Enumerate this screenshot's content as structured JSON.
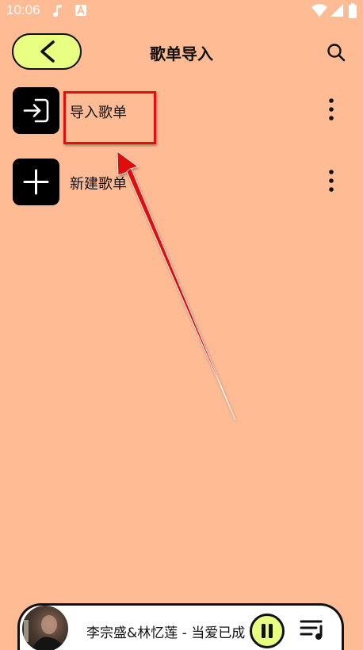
{
  "status_bar": {
    "time": "10:06",
    "icons": [
      "music-note-icon",
      "font-a-icon",
      "wifi-icon",
      "signal-icon",
      "battery-icon"
    ]
  },
  "header": {
    "title": "歌单导入",
    "back_icon": "chevron-left-icon",
    "search_icon": "search-icon"
  },
  "list": [
    {
      "label": "导入歌单",
      "icon": "import-icon",
      "more_icon": "more-vertical-icon"
    },
    {
      "label": "新建歌单",
      "icon": "plus-icon",
      "more_icon": "more-vertical-icon"
    }
  ],
  "player": {
    "song": "李宗盛&林忆莲 - 当爱已成往事",
    "state": "playing",
    "pause_icon": "pause-icon",
    "playlist_icon": "playlist-icon"
  },
  "colors": {
    "background": "#FFBB94",
    "accent": "#E8FF82",
    "annotation": "#E01010"
  }
}
